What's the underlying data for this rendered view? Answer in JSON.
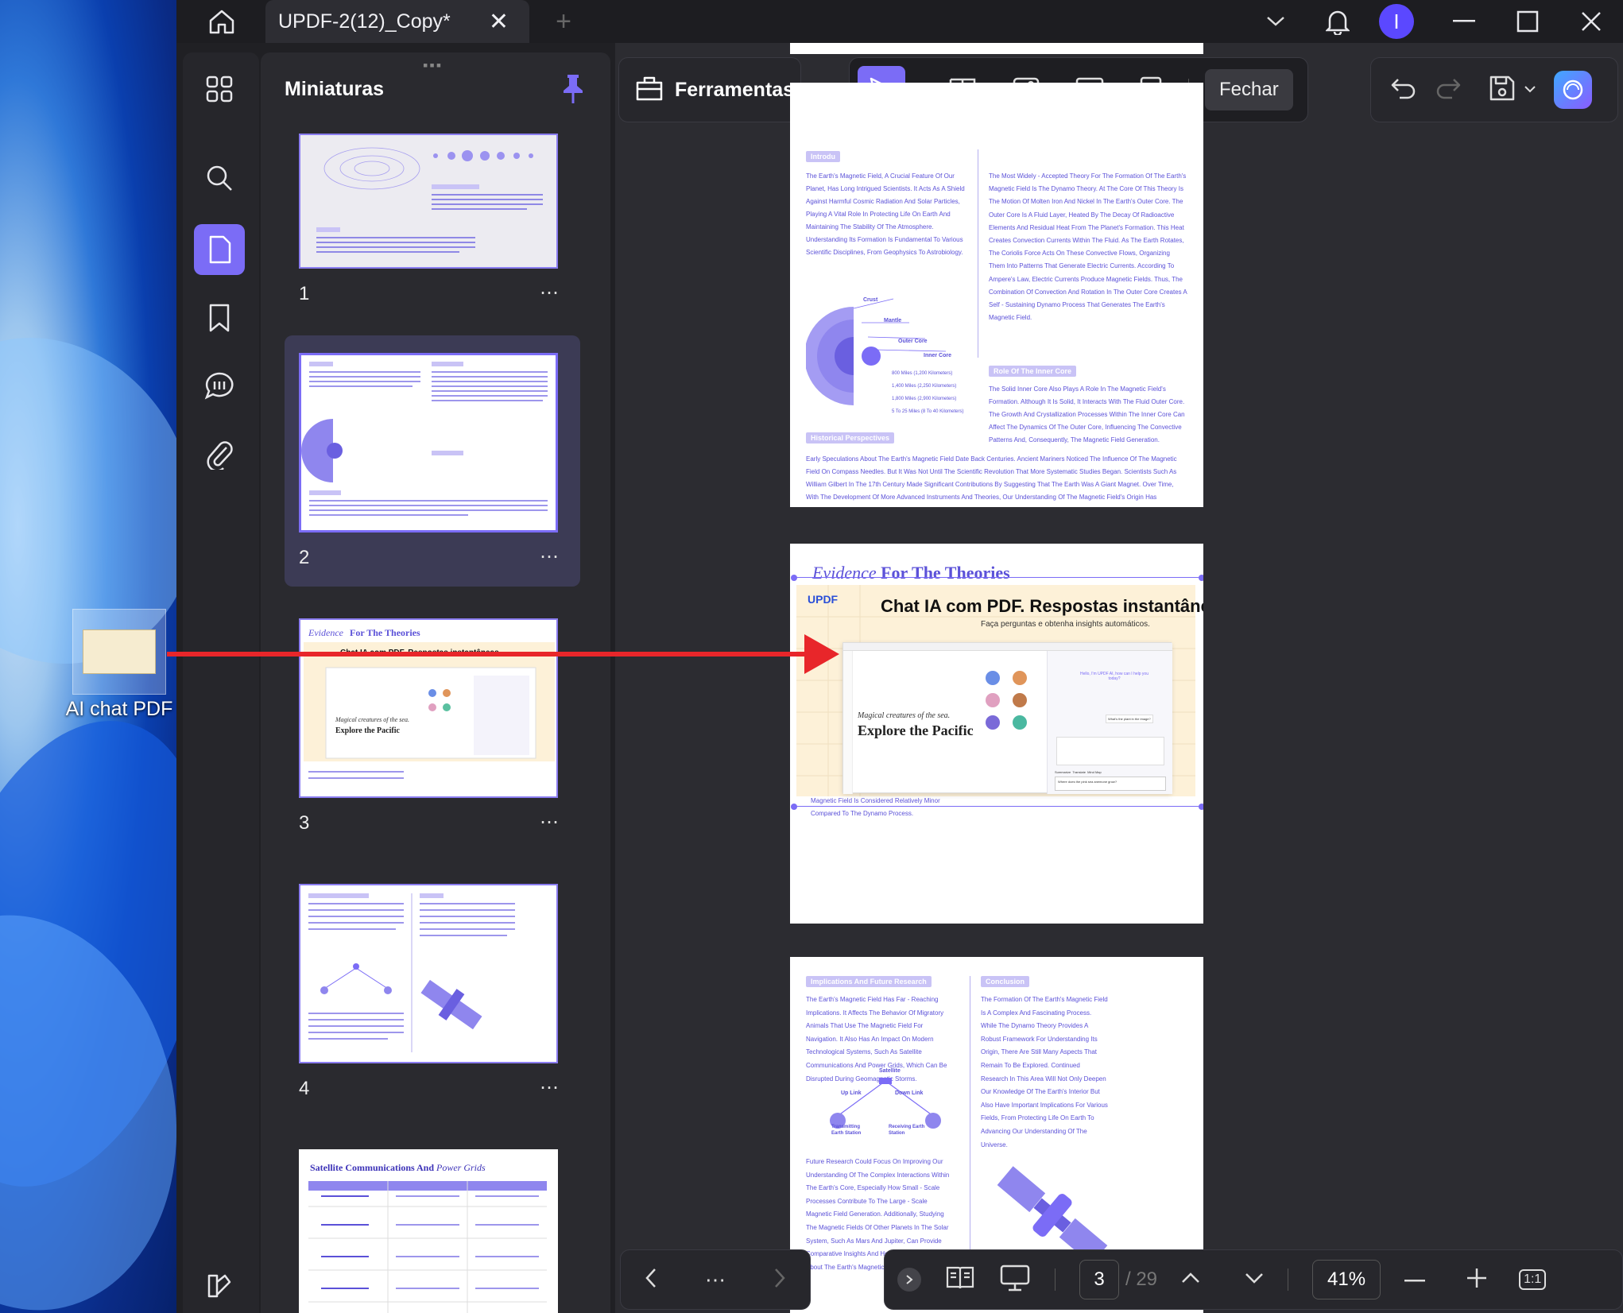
{
  "desktop": {
    "icon_label": "AI chat PDF"
  },
  "titlebar": {
    "doc_tab": "UPDF-2(12)_Copy*",
    "avatar_letter": "I"
  },
  "thumbnails": {
    "title": "Miniaturas",
    "pages": [
      {
        "number": "1"
      },
      {
        "number": "2"
      },
      {
        "number": "3"
      },
      {
        "number": "4"
      }
    ],
    "page5_title": "Satellite Communications And",
    "page5_title_italic": "Power Grids",
    "more": "⋯"
  },
  "toolbar": {
    "tools_label": "Ferramentas",
    "close_label": "Fechar"
  },
  "page2": {
    "intro_pill": "Introdu",
    "intro_text": "The Earth's Magnetic Field, A Crucial Feature Of Our Planet, Has Long Intrigued Scientists. It Acts As A Shield Against Harmful Cosmic Radiation And Solar Particles, Playing A Vital Role In Protecting Life On Earth And Maintaining The Stability Of The Atmosphere. Understanding Its Formation Is Fundamental To Various Scientific Disciplines, From Geophysics To Astrobiology.",
    "layers": [
      "Crust",
      "Mantle",
      "Outer Core",
      "Inner Core"
    ],
    "distances": [
      "800 Miles (1,200 Kilometers)",
      "1,400 Miles (2,250 Kilometers)",
      "1,800 Miles (2,900 Kilometers)",
      "5 To 25 Miles (8 To 40 Kilometers)"
    ],
    "right_text": "The Most Widely - Accepted Theory For The Formation Of The Earth's Magnetic Field Is The Dynamo Theory. At The Core Of This Theory Is The Motion Of Molten Iron And Nickel In The Earth's Outer Core. The Outer Core Is A Fluid Layer, Heated By The Decay Of Radioactive Elements And Residual Heat From The Planet's Formation. This Heat Creates Convection Currents Within The Fluid. As The Earth Rotates, The Coriolis Force Acts On These Convective Flows, Organizing Them Into Patterns That Generate Electric Currents. According To Ampere's Law, Electric Currents Produce Magnetic Fields. Thus, The Combination Of Convection And Rotation In The Outer Core Creates A Self - Sustaining Dynamo Process That Generates The Earth's Magnetic Field.",
    "inner_core_pill": "Role Of The Inner Core",
    "inner_core_text": "The Solid Inner Core Also Plays A Role In The Magnetic Field's Formation. Although It Is Solid, It Interacts With The Fluid Outer Core. The Growth And Crystallization Processes Within The Inner Core Can Affect The Dynamics Of The Outer Core, Influencing The Convective Patterns And, Consequently, The Magnetic Field Generation.",
    "historical_pill": "Historical Perspectives",
    "historical_text": "Early Speculations About The Earth's Magnetic Field Date Back Centuries. Ancient Mariners Noticed The Influence Of The Magnetic Field On Compass Needles. But It Was Not Until The Scientific Revolution That More Systematic Studies Began. Scientists Such As William Gilbert In The 17th Century Made Significant Contributions By Suggesting That The Earth Was A Giant Magnet. Over Time, With The Development Of More Advanced Instruments And Theories, Our Understanding Of The Magnetic Field's Origin Has Evolved."
  },
  "page3": {
    "heading_italic": "Evidence",
    "heading_bold": "For The Theories",
    "brand": "UPDF",
    "banner_title": "Chat IA com PDF. Respostas instantâneas.",
    "banner_sub": "Faça perguntas e obtenha insights automáticos.",
    "magazine_italic": "Magical creatures of the sea.",
    "magazine_title": "Explore the Pacific",
    "chat_greeting": "Hello, I'm UPDF AI, how can I help you today?",
    "chat_question": "What's the plant in the image?",
    "chat_input": "Where does the pink sea anemone grow?",
    "chat_actions": [
      "Summarize",
      "Translate",
      "Mind Map"
    ],
    "footer_text_1": "Magnetic Field Is Considered Relatively Minor",
    "footer_text_2": "Compared To The Dynamo Process."
  },
  "page4": {
    "left_pill": "Implications And Future Research",
    "left_text": "The Earth's Magnetic Field Has Far - Reaching Implications. It Affects The Behavior Of Migratory Animals That Use The Magnetic Field For Navigation. It Also Has An Impact On Modern Technological Systems, Such As Satellite Communications And Power Grids, Which Can Be Disrupted During Geomagnetic Storms.",
    "diagram": {
      "satellite": "Satellite",
      "up_link": "Up Link",
      "down_link": "Down Link",
      "tx": "Transmitting Earth Station",
      "rx": "Receiving Earth Station"
    },
    "left_text2": "Future Research Could Focus On Improving Our Understanding Of The Complex Interactions Within The Earth's Core, Especially How Small - Scale Processes Contribute To The Large - Scale Magnetic Field Generation. Additionally, Studying The Magnetic Fields Of Other Planets In The Solar System, Such As Mars And Jupiter, Can Provide Comparative Insights And Help Refine Our Theories About The Earth's Magnetic Field Formati",
    "right_pill": "Conclusion",
    "right_text": "The Formation Of The Earth's Magnetic Field Is A Complex And Fascinating Process. While The Dynamo Theory Provides A Robust Framework For Understanding Its Origin, There Are Still Many Aspects That Remain To Be Explored. Continued Research In This Area Will Not Only Deepen Our Knowledge Of The Earth's Interior But Also Have Important Implications For Various Fields, From Protecting Life On Earth To Advancing Our Understanding Of The Universe."
  },
  "bottom": {
    "current_page": "3",
    "total_pages": "/ 29",
    "zoom": "41%",
    "fit_label": "1:1",
    "more": "⋯"
  },
  "colors": {
    "accent": "#7b6cf6",
    "arrow": "#e8262a",
    "pdf_text": "#5b51d8"
  }
}
